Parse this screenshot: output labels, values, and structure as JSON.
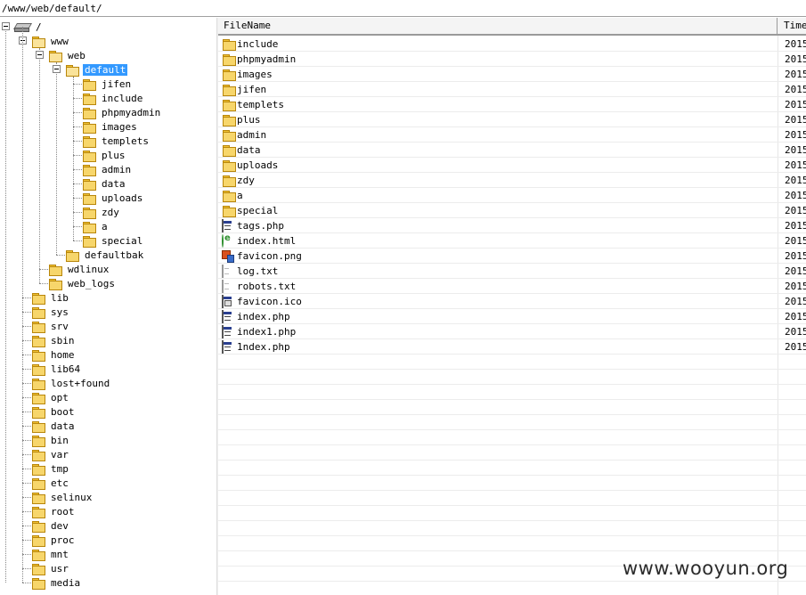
{
  "path_bar": {
    "value": "/www/web/default/"
  },
  "tree": {
    "root_label": "/",
    "www": "www",
    "web": "web",
    "default": "default",
    "default_children": [
      "jifen",
      "include",
      "phpmyadmin",
      "images",
      "templets",
      "plus",
      "admin",
      "data",
      "uploads",
      "zdy",
      "a",
      "special"
    ],
    "defaultbak": "defaultbak",
    "www_siblings": [
      "wdlinux",
      "web_logs"
    ],
    "root_children": [
      "lib",
      "sys",
      "srv",
      "sbin",
      "home",
      "lib64",
      "lost+found",
      "opt",
      "boot",
      "data",
      "bin",
      "var",
      "tmp",
      "etc",
      "selinux",
      "root",
      "dev",
      "proc",
      "mnt",
      "usr",
      "media"
    ]
  },
  "list": {
    "columns": {
      "name": "FileName",
      "time": "Time"
    },
    "files": [
      {
        "name": "include",
        "type": "folder",
        "time": "2015"
      },
      {
        "name": "phpmyadmin",
        "type": "folder",
        "time": "2015"
      },
      {
        "name": "images",
        "type": "folder",
        "time": "2015"
      },
      {
        "name": "jifen",
        "type": "folder",
        "time": "2015"
      },
      {
        "name": "templets",
        "type": "folder",
        "time": "2015"
      },
      {
        "name": "plus",
        "type": "folder",
        "time": "2015"
      },
      {
        "name": "admin",
        "type": "folder",
        "time": "2015"
      },
      {
        "name": "data",
        "type": "folder",
        "time": "2015"
      },
      {
        "name": "uploads",
        "type": "folder",
        "time": "2015"
      },
      {
        "name": "zdy",
        "type": "folder",
        "time": "2015"
      },
      {
        "name": "a",
        "type": "folder",
        "time": "2015"
      },
      {
        "name": "special",
        "type": "folder",
        "time": "2015"
      },
      {
        "name": "tags.php",
        "type": "php",
        "time": "2015"
      },
      {
        "name": "index.html",
        "type": "html",
        "time": "2015"
      },
      {
        "name": "favicon.png",
        "type": "png",
        "time": "2015"
      },
      {
        "name": "log.txt",
        "type": "txt",
        "time": "2015"
      },
      {
        "name": "robots.txt",
        "type": "txt",
        "time": "2015"
      },
      {
        "name": "favicon.ico",
        "type": "ico",
        "time": "2015"
      },
      {
        "name": "index.php",
        "type": "php",
        "time": "2015"
      },
      {
        "name": "index1.php",
        "type": "php",
        "time": "2015"
      },
      {
        "name": "1ndex.php",
        "type": "php",
        "time": "2015"
      }
    ]
  },
  "watermark": "www.wooyun.org",
  "colors": {
    "selection": "#3399ff",
    "folder": "#f7d66b"
  }
}
